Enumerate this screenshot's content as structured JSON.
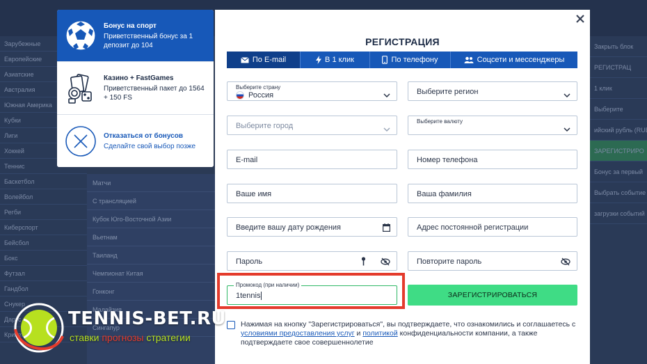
{
  "background": {
    "left_items": [
      "Зарубежные",
      "Европейские",
      "Азиатские",
      "Австралия",
      "Южная Америка",
      "Кубки",
      "Лиги",
      "Хоккей",
      "Теннис",
      "Баскетбол",
      "Волейбол",
      "Регби",
      "Киберспорт",
      "Бейсбол",
      "Бокс",
      "Футзал",
      "Гандбол",
      "Снукер",
      "Дартс",
      "Крикет"
    ],
    "mid_items": [
      "Матчи",
      "С трансляцией",
      "Кубок Юго-Восточной Азии",
      "Вьетнам",
      "Таиланд",
      "Чемпионат Китая",
      "Гонконг",
      "Малайзия",
      "Сингапур"
    ],
    "right_items": [
      "Закрыть блок",
      "РЕГИСТРАЦ",
      "1 клик",
      "Выберите",
      "ийский рубль (RUB)",
      "ЗАРЕГИСТРИРО",
      "Бонус за первый",
      "Выбрать событие",
      "загрузки событий"
    ]
  },
  "bonus_panel": {
    "sport": {
      "title": "Бонус на спорт",
      "desc": "Приветственный бонус за 1 депозит до 104"
    },
    "casino": {
      "title": "Казино + FastGames",
      "desc": "Приветственный пакет до 1564",
      "desc2": "+ 150 FS"
    },
    "refuse": {
      "title": "Отказаться от бонусов",
      "desc": "Сделайте свой выбор позже"
    }
  },
  "modal": {
    "title": "РЕГИСТРАЦИЯ",
    "tabs": [
      {
        "label": "По E-mail",
        "icon": "envelope-icon"
      },
      {
        "label": "В 1 клик",
        "icon": "lightning-icon"
      },
      {
        "label": "По телефону",
        "icon": "phone-icon"
      },
      {
        "label": "Соцсети и мессенджеры",
        "icon": "users-icon"
      }
    ],
    "fields": {
      "country_label": "Выберите страну",
      "country_value": "Россия",
      "region": "Выберите регион",
      "city": "Выберите город",
      "currency_label": "Выберите валюту",
      "email": "E-mail",
      "phone": "Номер телефона",
      "first_name": "Ваше имя",
      "last_name": "Ваша фамилия",
      "birth_date": "Введите вашу дату рождения",
      "address": "Адрес постоянной регистрации",
      "password": "Пароль",
      "repeat_password": "Повторите пароль",
      "promo_label": "Промокод (при наличии)",
      "promo_value": "1tennis"
    },
    "register_button": "ЗАРЕГИСТРИРОВАТЬСЯ",
    "agreement": {
      "part1": "Нажимая на кнопку \"Зарегистрироваться\", вы подтверждаете, что ознакомились и соглашаетесь с ",
      "link1": "условиями предоставления услуг",
      "part2": " и ",
      "link2": "политикой",
      "part3": " конфиденциальности компании, а также подтверждаете свое совершеннолетие"
    }
  },
  "watermark": {
    "brand": "TENNIS-BET.RU",
    "tagline_1": "ставки",
    "tagline_2": "прогнозы",
    "tagline_3": "стратегии"
  },
  "colors": {
    "primary_blue": "#1758b8",
    "green_button": "#3fdc85",
    "highlight_red": "#e43b2c"
  }
}
